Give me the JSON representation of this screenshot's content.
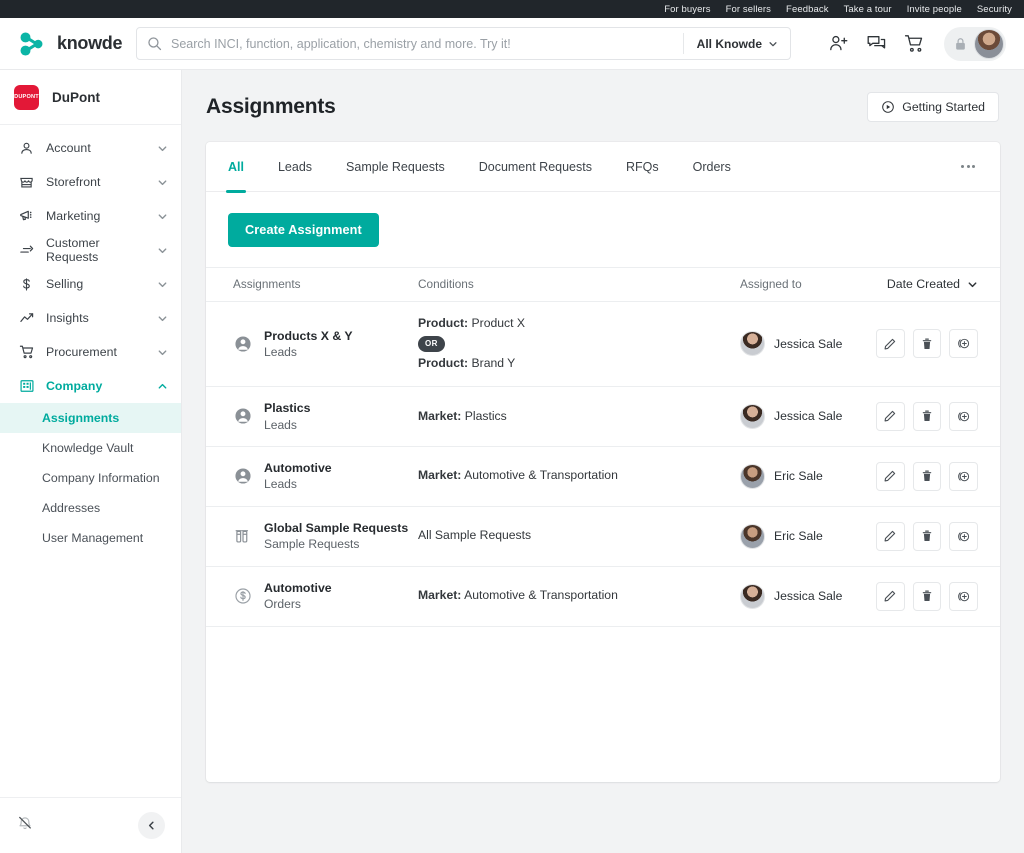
{
  "utility_bar": {
    "links": [
      "For buyers",
      "For sellers",
      "Feedback",
      "Take a tour",
      "Invite people",
      "Security"
    ]
  },
  "header": {
    "brand_name": "knowde",
    "search": {
      "placeholder": "Search INCI, function, application, chemistry and more. Try it!",
      "value": "",
      "scope_label": "All Knowde"
    },
    "icons": [
      "invite-user-icon",
      "messages-icon",
      "cart-icon",
      "lock-icon",
      "avatar"
    ]
  },
  "sidebar": {
    "org_name": "DuPont",
    "org_logo_text": "DUPONT",
    "items": [
      {
        "label": "Account",
        "icon": "person-icon",
        "expanded": false
      },
      {
        "label": "Storefront",
        "icon": "storefront-icon",
        "expanded": false
      },
      {
        "label": "Marketing",
        "icon": "megaphone-icon",
        "expanded": false
      },
      {
        "label": "Customer Requests",
        "icon": "requests-icon",
        "expanded": false
      },
      {
        "label": "Selling",
        "icon": "dollar-icon",
        "expanded": false
      },
      {
        "label": "Insights",
        "icon": "chart-line-icon",
        "expanded": false
      },
      {
        "label": "Procurement",
        "icon": "cart-icon",
        "expanded": false
      },
      {
        "label": "Company",
        "icon": "building-icon",
        "expanded": true
      }
    ],
    "subitems": [
      {
        "label": "Assignments",
        "current": true
      },
      {
        "label": "Knowledge Vault",
        "current": false
      },
      {
        "label": "Company Information",
        "current": false
      },
      {
        "label": "Addresses",
        "current": false
      },
      {
        "label": "User Management",
        "current": false
      }
    ],
    "footer": {
      "notifications_icon": "bell-off-icon",
      "collapse_icon": "chevron-left-icon"
    }
  },
  "main": {
    "page_title": "Assignments",
    "getting_started_label": "Getting Started",
    "tabs": [
      {
        "label": "All",
        "active": true
      },
      {
        "label": "Leads",
        "active": false
      },
      {
        "label": "Sample Requests",
        "active": false
      },
      {
        "label": "Document Requests",
        "active": false
      },
      {
        "label": "RFQs",
        "active": false
      },
      {
        "label": "Orders",
        "active": false
      }
    ],
    "create_button_label": "Create Assignment",
    "table": {
      "columns": [
        "Assignments",
        "Conditions",
        "Assigned to",
        "Date Created"
      ],
      "sort_label": "Date Created",
      "rows": [
        {
          "icon": "person-circle-icon",
          "name": "Products X & Y",
          "type": "Leads",
          "conditions": [
            {
              "key": "Product:",
              "value": "Product X"
            },
            {
              "operator": "OR"
            },
            {
              "key": "Product:",
              "value": "Brand Y"
            }
          ],
          "assignee": "Jessica Sale",
          "avatar": "female",
          "actions": [
            "edit-icon",
            "delete-icon",
            "duplicate-icon"
          ]
        },
        {
          "icon": "person-circle-icon",
          "name": "Plastics",
          "type": "Leads",
          "conditions": [
            {
              "key": "Market:",
              "value": "Plastics"
            }
          ],
          "assignee": "Jessica Sale",
          "avatar": "female",
          "actions": [
            "edit-icon",
            "delete-icon",
            "duplicate-icon"
          ]
        },
        {
          "icon": "person-circle-icon",
          "name": "Automotive",
          "type": "Leads",
          "conditions": [
            {
              "key": "Market:",
              "value": "Automotive & Transportation"
            }
          ],
          "assignee": "Eric Sale",
          "avatar": "male",
          "actions": [
            "edit-icon",
            "delete-icon",
            "duplicate-icon"
          ]
        },
        {
          "icon": "vials-icon",
          "name": "Global Sample Requests",
          "type": "Sample Requests",
          "conditions": [
            {
              "key": "",
              "value": "All Sample Requests"
            }
          ],
          "assignee": "Eric Sale",
          "avatar": "male",
          "actions": [
            "edit-icon",
            "delete-icon",
            "duplicate-icon"
          ]
        },
        {
          "icon": "dollar-circle-icon",
          "name": "Automotive",
          "type": "Orders",
          "conditions": [
            {
              "key": "Market:",
              "value": "Automotive & Transportation"
            }
          ],
          "assignee": "Jessica Sale",
          "avatar": "female",
          "actions": [
            "edit-icon",
            "delete-icon",
            "duplicate-icon"
          ]
        }
      ]
    }
  },
  "colors": {
    "accent": "#00ab9e",
    "accent_soft": "#e6f6f4",
    "topbar": "#21262b",
    "page_bg": "#f2f3f4",
    "brand_red": "#e31837"
  }
}
